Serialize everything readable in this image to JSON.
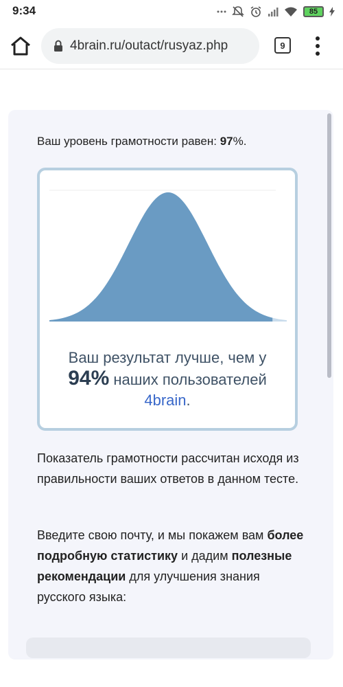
{
  "status_bar": {
    "time": "9:34",
    "battery": "85"
  },
  "browser": {
    "url": "4brain.ru/outact/rusyaz.php",
    "tab_count": "9"
  },
  "result": {
    "level_prefix": "Ваш уровень грамотности равен: ",
    "level_value": "97",
    "level_suffix": "%.",
    "better_line": "Ваш результат лучше, чем у",
    "percent": "94%",
    "users_text": " наших пользователей",
    "brand": "4brain",
    "brand_suffix": "."
  },
  "chart_data": {
    "type": "area",
    "title": "",
    "xlabel": "",
    "ylabel": "",
    "distribution": "normal",
    "highlight_percentile": 94,
    "colors": {
      "fill": "#6a9bc3",
      "unfilled": "#c9dcec"
    }
  },
  "info": {
    "explanation": "Показатель грамотности рассчитан исходя из правильности ваших ответов в данном тесте.",
    "cta_part1": "Введите свою почту, и мы покажем вам ",
    "cta_bold1": "более подробную статистику",
    "cta_part2": " и дадим ",
    "cta_bold2": "полезные рекомендации",
    "cta_part3": " для улучшения знания русского языка:"
  }
}
